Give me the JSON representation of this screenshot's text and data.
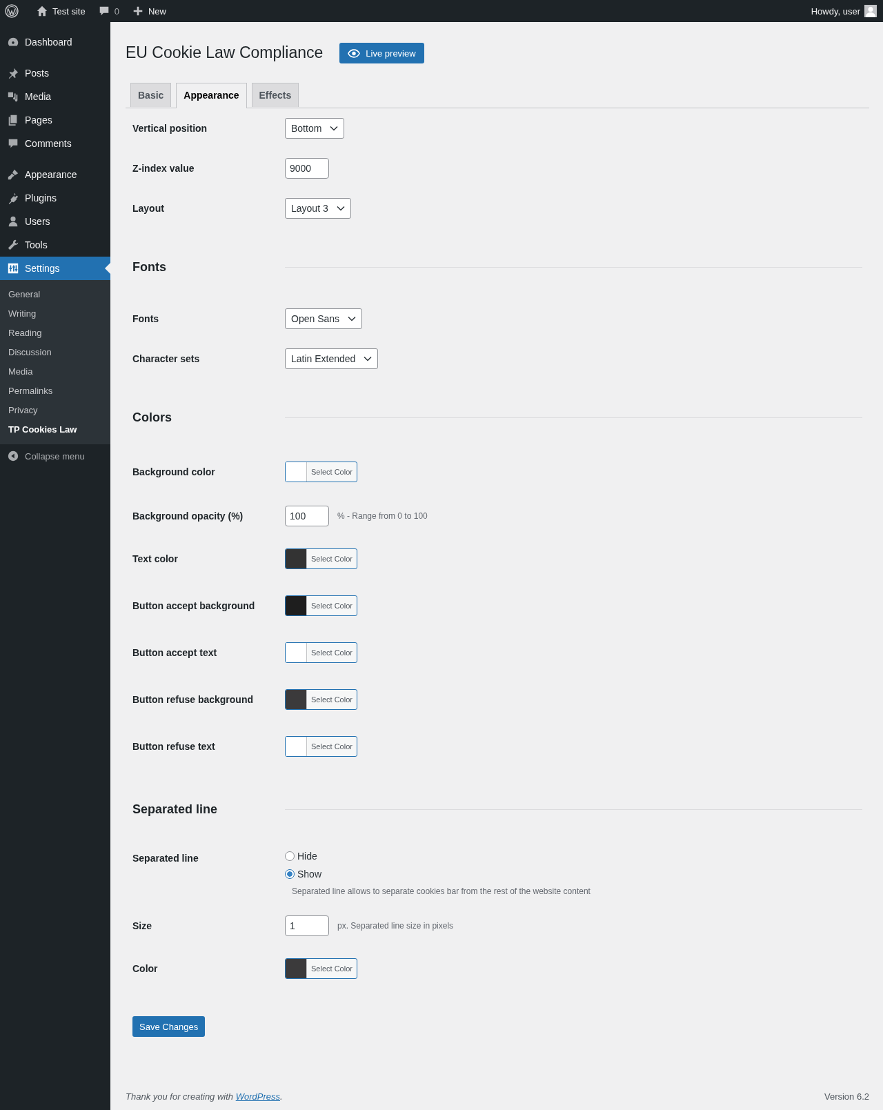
{
  "admin_bar": {
    "site": "Test site",
    "comments": "0",
    "new": "New",
    "greeting": "Howdy, user"
  },
  "sidebar": {
    "groups": [
      {
        "items": [
          {
            "label": "Dashboard",
            "selected": false
          }
        ]
      },
      {
        "items": [
          {
            "label": "Posts",
            "selected": false
          },
          {
            "label": "Media",
            "selected": false
          },
          {
            "label": "Pages",
            "selected": false
          },
          {
            "label": "Comments",
            "selected": false
          }
        ]
      },
      {
        "items": [
          {
            "label": "Appearance",
            "selected": false
          },
          {
            "label": "Plugins",
            "selected": false
          },
          {
            "label": "Users",
            "selected": false
          },
          {
            "label": "Tools",
            "selected": false
          },
          {
            "label": "Settings",
            "selected": true,
            "children": [
              {
                "label": "General",
                "selected": false
              },
              {
                "label": "Writing",
                "selected": false
              },
              {
                "label": "Reading",
                "selected": false
              },
              {
                "label": "Discussion",
                "selected": false
              },
              {
                "label": "Media",
                "selected": false
              },
              {
                "label": "Permalinks",
                "selected": false
              },
              {
                "label": "Privacy",
                "selected": false
              },
              {
                "label": "TP Cookies Law",
                "selected": true
              }
            ]
          }
        ]
      }
    ],
    "collapse": "Collapse menu"
  },
  "page": {
    "title": "EU Cookie Law Compliance",
    "preview_button": "Live preview"
  },
  "tabs": [
    {
      "label": "Basic",
      "selected": false
    },
    {
      "label": "Appearance",
      "selected": true
    },
    {
      "label": "Effects",
      "selected": false
    }
  ],
  "sections": [
    {
      "rows": [
        {
          "kind": "select",
          "label": "Vertical position",
          "value": "Bottom"
        },
        {
          "kind": "text",
          "label": "Z-index value",
          "value": "9000"
        },
        {
          "kind": "select",
          "label": "Layout",
          "value": "Layout 3"
        }
      ]
    },
    {
      "heading": "Fonts",
      "rows": [
        {
          "kind": "select",
          "label": "Fonts",
          "value": "Open Sans"
        },
        {
          "kind": "select",
          "label": "Character sets",
          "value": "Latin Extended"
        }
      ]
    },
    {
      "heading": "Colors",
      "rows": [
        {
          "kind": "color",
          "label": "Background color",
          "button": "Select Color",
          "color": "#ffffff"
        },
        {
          "kind": "text",
          "label": "Background opacity (%)",
          "value": "100",
          "hint": "% - Range from 0 to 100"
        },
        {
          "kind": "color",
          "label": "Text color",
          "button": "Select Color",
          "color": "#333333"
        },
        {
          "kind": "color",
          "label": "Button accept background",
          "button": "Select Color",
          "color": "#1e1e1e"
        },
        {
          "kind": "color",
          "label": "Button accept text",
          "button": "Select Color",
          "color": "#ffffff"
        },
        {
          "kind": "color",
          "label": "Button refuse background",
          "button": "Select Color",
          "color": "#3b3a3b"
        },
        {
          "kind": "color",
          "label": "Button refuse text",
          "button": "Select Color",
          "color": "#ffffff"
        }
      ]
    },
    {
      "heading": "Separated line",
      "rows": [
        {
          "kind": "radio",
          "label": "Separated line",
          "options": [
            {
              "label": "Hide",
              "selected": false
            },
            {
              "label": "Show",
              "selected": true
            }
          ],
          "description": "Separated line allows to separate cookies bar from the rest of the website content"
        },
        {
          "kind": "text",
          "label": "Size",
          "value": "1",
          "hint": "px. Separated line size in pixels"
        },
        {
          "kind": "color",
          "label": "Color",
          "button": "Select Color",
          "color": "#3b3a3b"
        }
      ]
    }
  ],
  "save_button": "Save Changes",
  "footer": {
    "text_before": "Thank you for creating with ",
    "link": "WordPress",
    "text_after": ".",
    "version": "Version 6.2"
  }
}
